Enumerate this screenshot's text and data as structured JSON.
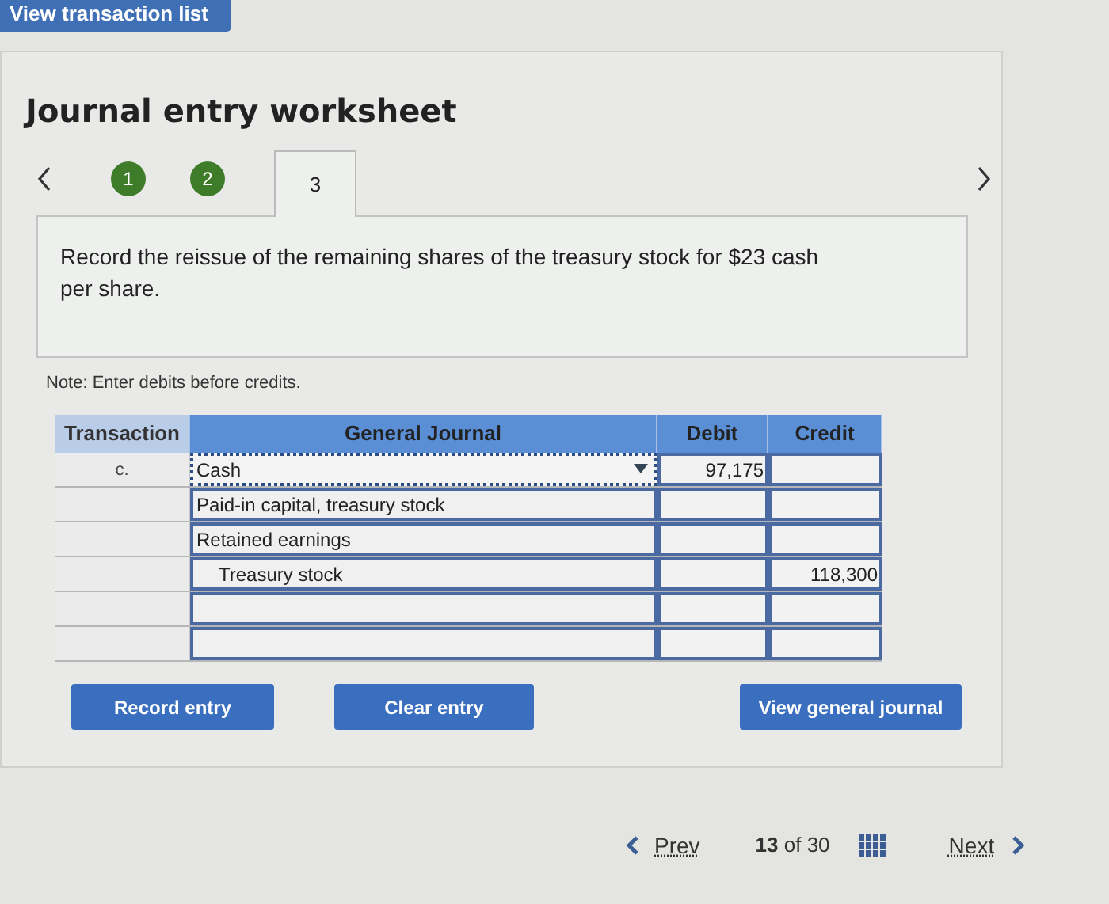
{
  "top_button": "View transaction list",
  "title": "Journal entry worksheet",
  "steps": [
    {
      "label": "1",
      "kind": "done",
      "selected": false
    },
    {
      "label": "2",
      "kind": "done",
      "selected": false
    },
    {
      "label": "3",
      "kind": "tab",
      "selected": true
    }
  ],
  "question": "Record the reissue of the remaining shares of the treasury stock for $23 cash per share.",
  "note": "Note: Enter debits before credits.",
  "table": {
    "columns": [
      "Transaction",
      "General Journal",
      "Debit",
      "Credit"
    ],
    "rows": [
      {
        "transaction": "c.",
        "account": "Cash",
        "indented": false,
        "selected": true,
        "debit": "97,175"
      },
      {
        "account": "Paid-in capital, treasury stock",
        "indented": false,
        "selected": false
      },
      {
        "account": "Retained earnings",
        "indented": false,
        "selected": false
      },
      {
        "account": "Treasury stock",
        "indented": true,
        "selected": false,
        "credit": "118,300"
      },
      {
        "selected": false
      },
      {
        "selected": false
      }
    ]
  },
  "buttons": [
    "Record entry",
    "Clear entry",
    "View general journal"
  ],
  "pager": {
    "prev": "Prev",
    "current": "13",
    "of": "of",
    "total": "30",
    "next": "Next"
  }
}
